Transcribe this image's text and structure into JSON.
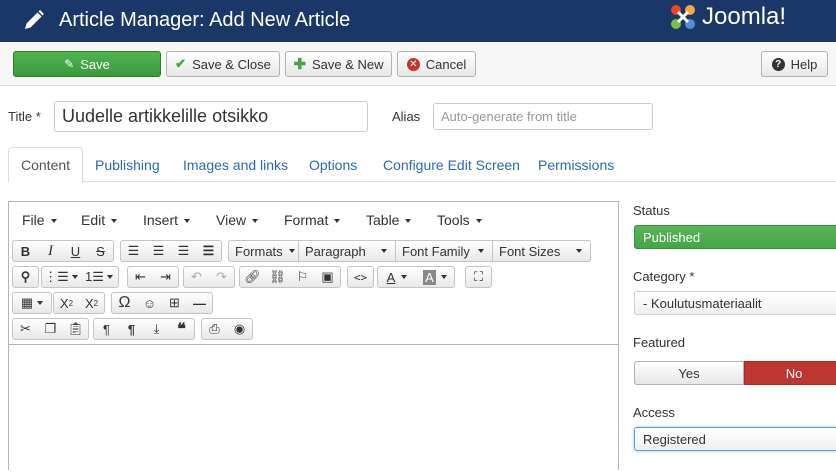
{
  "header": {
    "title": "Article Manager: Add New Article",
    "logo_text": "Joomla!"
  },
  "toolbar": {
    "save": "Save",
    "save_close": "Save & Close",
    "save_new": "Save & New",
    "cancel": "Cancel",
    "help": "Help"
  },
  "form": {
    "title_label": "Title *",
    "title_value": "Uudelle artikkelille otsikko",
    "alias_label": "Alias",
    "alias_placeholder": "Auto-generate from title"
  },
  "tabs": [
    "Content",
    "Publishing",
    "Images and links",
    "Options",
    "Configure Edit Screen",
    "Permissions"
  ],
  "editor": {
    "menus": [
      "File",
      "Edit",
      "Insert",
      "View",
      "Format",
      "Table",
      "Tools"
    ],
    "formats_label": "Formats",
    "paragraph_label": "Paragraph",
    "font_family_label": "Font Family",
    "font_sizes_label": "Font Sizes"
  },
  "sidebar": {
    "status_label": "Status",
    "status_value": "Published",
    "category_label": "Category *",
    "category_value": "- Koulutusmateriaalit",
    "featured_label": "Featured",
    "featured_yes": "Yes",
    "featured_no": "No",
    "access_label": "Access",
    "access_value": "Registered"
  },
  "colors": {
    "header_bg": "#1a3867",
    "save_green": "#46a546",
    "no_red": "#bd362f",
    "link_blue": "#2a69b8"
  }
}
